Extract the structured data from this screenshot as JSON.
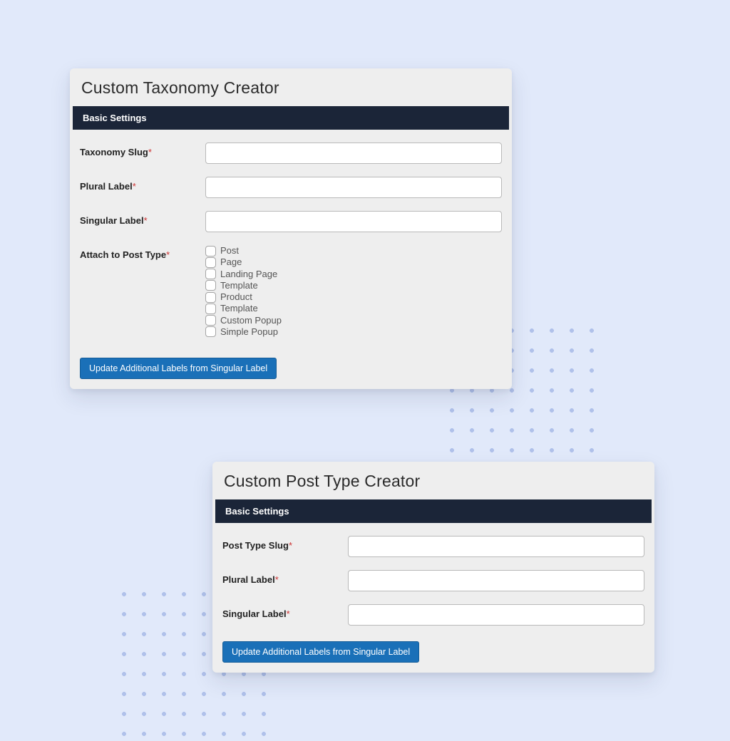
{
  "panel1": {
    "title": "Custom Taxonomy Creator",
    "section_header": "Basic Settings",
    "labels": {
      "taxonomy_slug": "Taxonomy Slug",
      "plural_label": "Plural Label",
      "singular_label": "Singular Label",
      "attach_post_type": "Attach to Post Type"
    },
    "post_types": [
      "Post",
      "Page",
      "Landing Page",
      "Template",
      "Product",
      "Template",
      "Custom Popup",
      "Simple Popup"
    ],
    "button_label": "Update Additional Labels from Singular Label"
  },
  "panel2": {
    "title": "Custom Post Type Creator",
    "section_header": "Basic Settings",
    "labels": {
      "post_type_slug": "Post Type Slug",
      "plural_label": "Plural Label",
      "singular_label": "Singular Label"
    },
    "button_label": "Update Additional Labels from Singular Label"
  },
  "required_marker": "*"
}
